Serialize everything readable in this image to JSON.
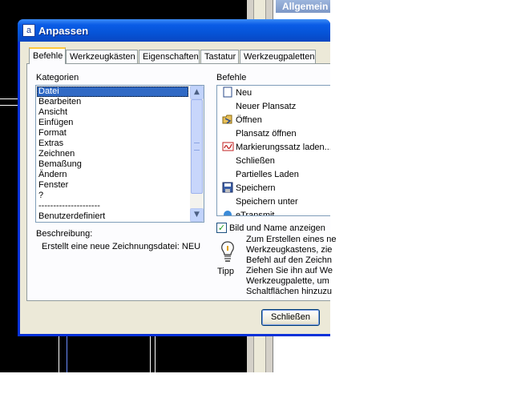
{
  "background_panel": {
    "header": "Allgemein"
  },
  "window": {
    "title": "Anpassen",
    "title_icon": "customize-icon"
  },
  "tabs": [
    {
      "label": "Befehle",
      "active": true
    },
    {
      "label": "Werkzeugkästen",
      "active": false
    },
    {
      "label": "Eigenschaften",
      "active": false
    },
    {
      "label": "Tastatur",
      "active": false
    },
    {
      "label": "Werkzeugpaletten",
      "active": false
    }
  ],
  "categories": {
    "label": "Kategorien",
    "items": [
      "Datei",
      "Bearbeiten",
      "Ansicht",
      "Einfügen",
      "Format",
      "Extras",
      "Zeichnen",
      "Bemaßung",
      "Ändern",
      "Fenster",
      "?",
      "---------------------",
      "Benutzerdefiniert"
    ],
    "selected": "Datei"
  },
  "commands": {
    "label": "Befehle",
    "items": [
      {
        "label": "Neu",
        "icon": "new-file-icon"
      },
      {
        "label": "Neuer Plansatz",
        "icon": ""
      },
      {
        "label": "Öffnen",
        "icon": "open-folder-icon"
      },
      {
        "label": "Plansatz öffnen",
        "icon": ""
      },
      {
        "label": "Markierungssatz laden...",
        "icon": "markup-icon"
      },
      {
        "label": "Schließen",
        "icon": ""
      },
      {
        "label": "Partielles Laden",
        "icon": ""
      },
      {
        "label": "Speichern",
        "icon": "save-disk-icon"
      },
      {
        "label": "Speichern unter",
        "icon": ""
      },
      {
        "label": "eTransmit",
        "icon": "etransmit-icon"
      }
    ]
  },
  "show_image_name": {
    "label": "Bild und Name anzeigen",
    "checked": true
  },
  "description": {
    "label": "Beschreibung:",
    "text": "Erstellt eine neue Zeichnungsdatei:  NEU"
  },
  "tip": {
    "label": "Tipp",
    "lines": [
      "Zum Erstellen eines ne",
      "Werkzeugkastens, zie",
      "Befehl auf den Zeichn",
      "Ziehen Sie ihn auf We",
      "Werkzeugpalette, um",
      "Schaltflächen hinzuzu"
    ]
  },
  "buttons": {
    "close": "Schließen"
  }
}
